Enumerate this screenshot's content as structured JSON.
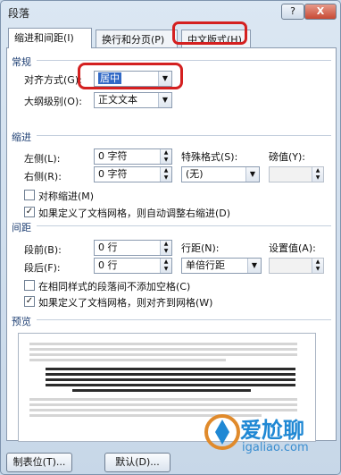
{
  "window": {
    "title": "段落",
    "help_label": "?",
    "close_label": "X"
  },
  "tabs": [
    {
      "label": "缩进和间距(I)"
    },
    {
      "label": "换行和分页(P)"
    },
    {
      "label": "中文版式(H)"
    }
  ],
  "general": {
    "section_title": "常规",
    "alignment_label": "对齐方式(G):",
    "alignment_value": "居中",
    "outline_label": "大纲级别(O):",
    "outline_value": "正文文本"
  },
  "indent": {
    "section_title": "缩进",
    "left_label": "左侧(L):",
    "left_value": "0 字符",
    "right_label": "右侧(R):",
    "right_value": "0 字符",
    "special_label": "特殊格式(S):",
    "special_value": "(无)",
    "measure_label": "磅值(Y):",
    "measure_value": "",
    "mirror_label": "对称缩进(M)",
    "mirror_checked": false,
    "grid_label": "如果定义了文档网格，则自动调整右缩进(D)",
    "grid_checked": true
  },
  "spacing": {
    "section_title": "间距",
    "before_label": "段前(B):",
    "before_value": "0 行",
    "after_label": "段后(F):",
    "after_value": "0 行",
    "line_label": "行距(N):",
    "line_value": "单倍行距",
    "at_label": "设置值(A):",
    "at_value": "",
    "nospace_label": "在相同样式的段落间不添加空格(C)",
    "nospace_checked": false,
    "snap_label": "如果定义了文档网格，则对齐到网格(W)",
    "snap_checked": true
  },
  "preview": {
    "section_title": "预览"
  },
  "buttons": {
    "tabs_label": "制表位(T)...",
    "default_label": "默认(D)..."
  },
  "watermark": {
    "text": "爱尬聊",
    "url": "igaliao.com"
  },
  "colors": {
    "highlight": "#d42020",
    "selection": "#3169c6",
    "accent": "#1e3f73"
  }
}
